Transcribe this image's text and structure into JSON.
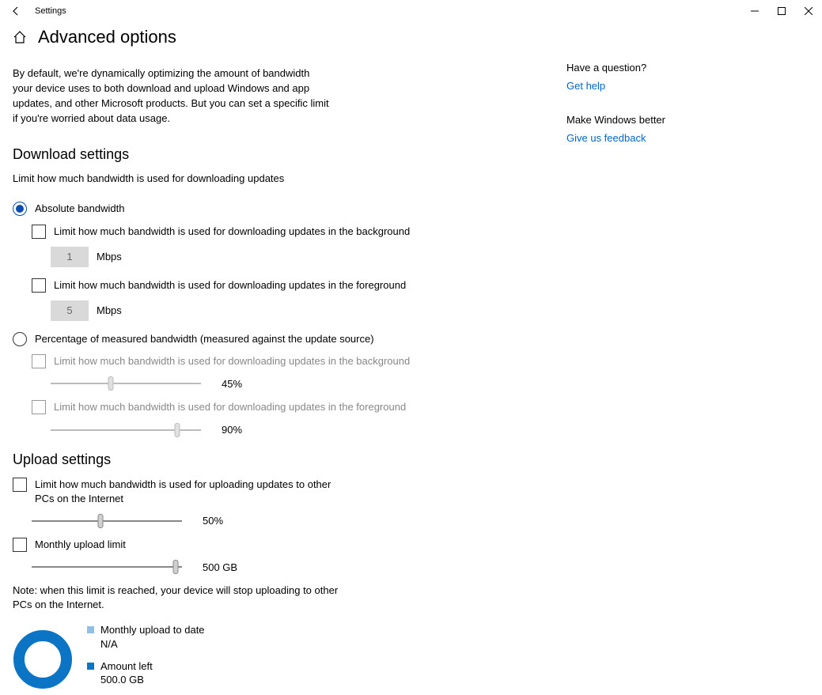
{
  "app": {
    "title": "Settings"
  },
  "page": {
    "title": "Advanced options",
    "intro": "By default, we're dynamically optimizing the amount of bandwidth your device uses to both download and upload Windows and app updates, and other Microsoft products. But you can set a specific limit if you're worried about data usage."
  },
  "download": {
    "heading": "Download settings",
    "desc": "Limit how much bandwidth is used for downloading updates",
    "absolute": {
      "label": "Absolute bandwidth",
      "bg_check": "Limit how much bandwidth is used for downloading updates in the background",
      "bg_value": "1",
      "fg_check": "Limit how much bandwidth is used for downloading updates in the foreground",
      "fg_value": "5",
      "unit": "Mbps"
    },
    "percent": {
      "label": "Percentage of measured bandwidth (measured against the update source)",
      "bg_check": "Limit how much bandwidth is used for downloading updates in the background",
      "bg_value": "45%",
      "bg_pos": 40,
      "fg_check": "Limit how much bandwidth is used for downloading updates in the foreground",
      "fg_value": "90%",
      "fg_pos": 84
    }
  },
  "upload": {
    "heading": "Upload settings",
    "limit_label": "Limit how much bandwidth is used for uploading updates to other PCs on the Internet",
    "limit_value": "50%",
    "limit_pos": 46,
    "monthly_label": "Monthly upload limit",
    "monthly_value": "500 GB",
    "monthly_pos": 96,
    "note": "Note: when this limit is reached, your device will stop uploading to other PCs on the Internet.",
    "legend": {
      "todate_label": "Monthly upload to date",
      "todate_value": "N/A",
      "left_label": "Amount left",
      "left_value": "500.0 GB"
    }
  },
  "chart_data": {
    "type": "pie",
    "title": "Monthly upload",
    "series": [
      {
        "name": "Monthly upload to date",
        "value": 0,
        "color": "#8fc1e8"
      },
      {
        "name": "Amount left",
        "value": 500.0,
        "color": "#0b74c4"
      }
    ],
    "unit": "GB"
  },
  "aside": {
    "q_heading": "Have a question?",
    "q_link": "Get help",
    "fb_heading": "Make Windows better",
    "fb_link": "Give us feedback"
  },
  "colors": {
    "donut_ring": "#0b74c4",
    "swatch_todate": "#8fc1e8",
    "swatch_left": "#0b74c4"
  }
}
